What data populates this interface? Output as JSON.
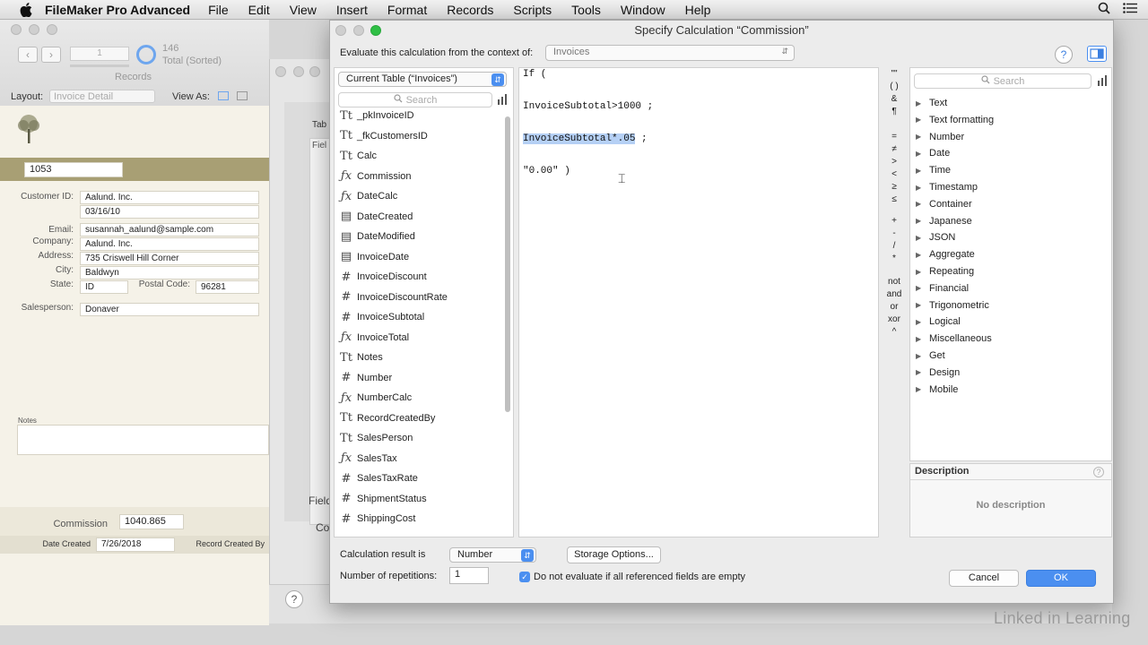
{
  "menubar": {
    "app": "FileMaker Pro Advanced",
    "items": [
      "File",
      "Edit",
      "View",
      "Insert",
      "Format",
      "Records",
      "Scripts",
      "Tools",
      "Window",
      "Help"
    ]
  },
  "bgwindow": {
    "record_number": "1",
    "total": "146",
    "total_label": "Total (Sorted)",
    "records_label": "Records",
    "layout_label": "Layout:",
    "layout_value": "Invoice Detail",
    "view_as_label": "View As:",
    "invoice_id": "1053",
    "customer_id_label": "Customer ID:",
    "customer_id": "Aalund. Inc.",
    "date": "03/16/10",
    "email_label": "Email:",
    "email": "susannah_aalund@sample.com",
    "company_label": "Company:",
    "company": "Aalund. Inc.",
    "address_label": "Address:",
    "address": "735 Criswell Hill Corner",
    "city_label": "City:",
    "city": "Baldwyn",
    "state_label": "State:",
    "state": "ID",
    "postal_label": "Postal Code:",
    "postal": "96281",
    "salesperson_label": "Salesperson:",
    "salesperson": "Donaver",
    "notes_label": "Notes",
    "commission_label": "Commission",
    "commission": "1040.865",
    "date_created_label": "Date Created",
    "date_created": "7/26/2018",
    "record_created_by_label": "Record Created By"
  },
  "midwin": {
    "tab_label": "Tab",
    "field_label": "Fiel",
    "bottom_label": "Field",
    "co_label": "Co"
  },
  "dialog": {
    "title": "Specify Calculation “Commission”",
    "context_label": "Evaluate this calculation from the context of:",
    "context_value": "Invoices",
    "table_select": "Current Table (“Invoices”)",
    "search_placeholder": "Search",
    "fields": [
      {
        "type": "Tt",
        "name": "_pkInvoiceID"
      },
      {
        "type": "Tt",
        "name": "_fkCustomersID"
      },
      {
        "type": "Tt",
        "name": "Calc"
      },
      {
        "type": "fx",
        "name": "Commission"
      },
      {
        "type": "fx",
        "name": "DateCalc"
      },
      {
        "type": "cal",
        "name": "DateCreated"
      },
      {
        "type": "calclock",
        "name": "DateModified"
      },
      {
        "type": "cal",
        "name": "InvoiceDate"
      },
      {
        "type": "#",
        "name": "InvoiceDiscount"
      },
      {
        "type": "#",
        "name": "InvoiceDiscountRate"
      },
      {
        "type": "#",
        "name": "InvoiceSubtotal"
      },
      {
        "type": "fx",
        "name": "InvoiceTotal"
      },
      {
        "type": "Tt",
        "name": "Notes"
      },
      {
        "type": "#",
        "name": "Number"
      },
      {
        "type": "fx",
        "name": "NumberCalc"
      },
      {
        "type": "Tt",
        "name": "RecordCreatedBy"
      },
      {
        "type": "Tt",
        "name": "SalesPerson"
      },
      {
        "type": "fx",
        "name": "SalesTax"
      },
      {
        "type": "#",
        "name": "SalesTaxRate"
      },
      {
        "type": "#",
        "name": "ShipmentStatus"
      },
      {
        "type": "#",
        "name": "ShippingCost"
      }
    ],
    "code": {
      "line1": "If (",
      "line2": "InvoiceSubtotal>1000 ;",
      "line3_hl": "InvoiceSubtotal*.05",
      "line3_rest": " ;",
      "line4": "\"0.00\" )"
    },
    "operators": [
      "\"\"",
      "( )",
      "&",
      "¶",
      "=",
      "≠",
      ">",
      "<",
      "≥",
      "≤",
      "+",
      "-",
      "/",
      "*",
      "not",
      "and",
      "or",
      "xor",
      "^"
    ],
    "functions": [
      "Text",
      "Text formatting",
      "Number",
      "Date",
      "Time",
      "Timestamp",
      "Container",
      "Japanese",
      "JSON",
      "Aggregate",
      "Repeating",
      "Financial",
      "Trigonometric",
      "Logical",
      "Miscellaneous",
      "Get",
      "Design",
      "Mobile"
    ],
    "description_label": "Description",
    "no_description": "No description",
    "result_label": "Calculation result is",
    "result_value": "Number",
    "storage_button": "Storage Options...",
    "repetitions_label": "Number of repetitions:",
    "repetitions_value": "1",
    "do_not_evaluate": "Do not evaluate if all referenced fields are empty",
    "cancel": "Cancel",
    "ok": "OK"
  },
  "watermark": "Linked in Learning",
  "colors": {
    "accent": "#4b8ff0",
    "selection": "#b5d0f5"
  }
}
